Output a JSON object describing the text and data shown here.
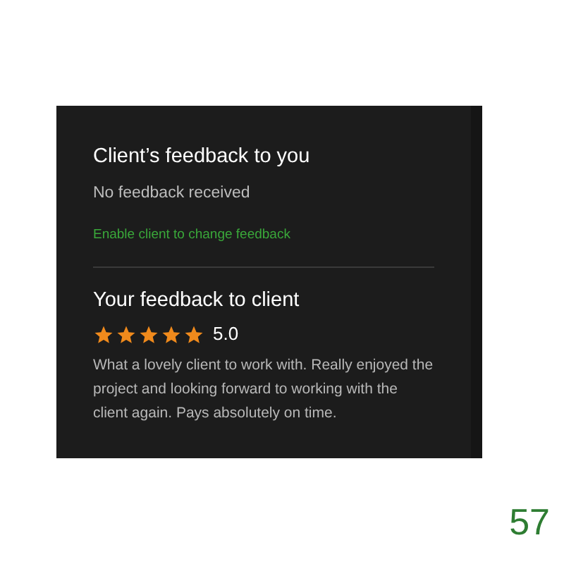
{
  "client_feedback": {
    "title": "Client’s feedback to you",
    "status": "No feedback received",
    "link": "Enable client to change feedback"
  },
  "your_feedback": {
    "title": "Your feedback to client",
    "stars": 5,
    "rating": "5.0",
    "comment": "What a lovely client to work with. Really enjoyed the project and looking forward to working with the client again. Pays absolutely on time."
  },
  "page_number": "57"
}
